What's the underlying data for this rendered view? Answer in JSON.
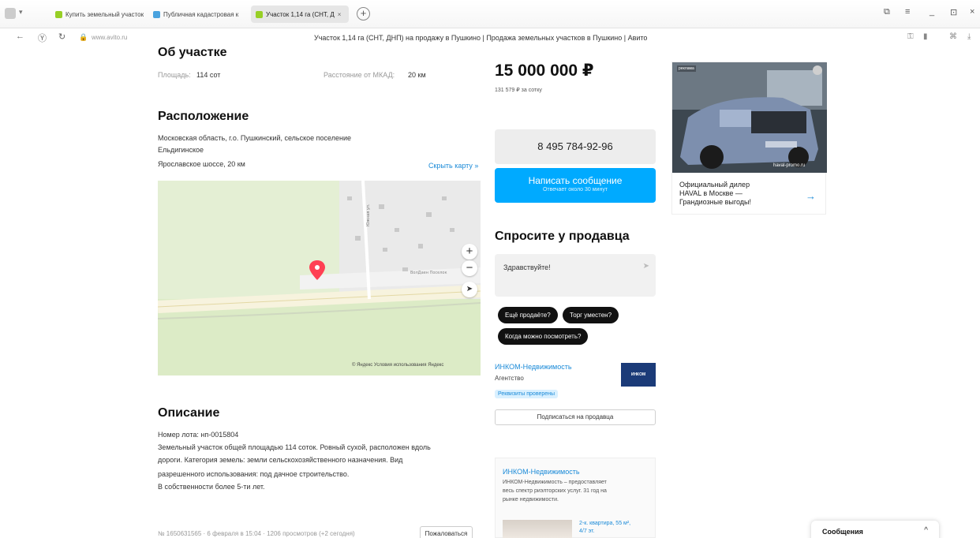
{
  "browser": {
    "tabs": [
      {
        "label": "Купить земельный участок",
        "color": "#97cf26"
      },
      {
        "label": "Публичная кадастровая к",
        "color": "#4aa3df"
      },
      {
        "label": "Участок 1,14 га (СНТ, Д",
        "color": "#97cf26",
        "close": "×"
      }
    ],
    "new_tab": "+",
    "url": "www.avito.ru",
    "page_title": "Участок 1,14 га (СНТ, ДНП) на продажу в Пушкино | Продажа земельных участков в Пушкино | Авито"
  },
  "about": {
    "heading": "Об участке",
    "area_label": "Площадь:",
    "area_value": "114 сот",
    "distance_label": "Расстояние от МКАД:",
    "distance_value": "20 км"
  },
  "location": {
    "heading": "Расположение",
    "address_line1": "Московская область, г.о. Пушкинский, сельское поселение",
    "address_line2": "Ельдигинское",
    "highway": "Ярославское шоссе, 20 км",
    "hide_map": "Скрыть карту »",
    "map_label_street": "Южная ул.",
    "map_label_area": "ВолДаен Поселок",
    "map_footer": "© Яндекс Условия использования  Яндекс",
    "zoom_in": "+",
    "zoom_out": "−",
    "locate": "➤"
  },
  "description": {
    "heading": "Описание",
    "lot": "Номер лота: нп-0015804",
    "text1": "Земельный участок общей площадью 114 соток. Ровный сухой, расположен вдоль",
    "text2": "дороги. Категория земель: земли сельскохозяйственного назначения. Вид",
    "text3": "разрешенного использования: под дачное строительство.",
    "text4": "В собственности более 5-ти лет."
  },
  "footer": {
    "meta": "№ 1650631565 · 6 февраля в 15:04 · 1206 просмотров (+2 сегодня)",
    "complain": "Пожаловаться"
  },
  "offer": {
    "price": "15 000 000 ₽",
    "per_unit": "131 579 ₽ за сотку",
    "phone": "8 495 784-92-96",
    "message_button": "Написать сообщение",
    "message_sub": "Отвечает около 30 минут"
  },
  "ask": {
    "heading": "Спросите у продавца",
    "placeholder": "Здравствуйте!",
    "chips": [
      "Ещё продаёте?",
      "Торг уместен?",
      "Когда можно посмотреть?"
    ]
  },
  "seller": {
    "name": "ИНКОМ-Недвижимость",
    "type": "Агентство",
    "badge": "Реквизиты проверены",
    "logo": "ИНКОМ",
    "subscribe": "Подписаться на продавца"
  },
  "seller_card": {
    "name": "ИНКОМ-Недвижимость",
    "desc1": "ИНКОМ-Недвижимость – предоставляет",
    "desc2": "весь спектр риэлторских услуг. 31 год на",
    "desc3": "рынке недвижимости.",
    "listing1": "2-к. квартира, 55 м²,",
    "listing2": "4/7 эт."
  },
  "ad": {
    "label": "реклама",
    "brand": "haval-promo.ru",
    "line1": "Официальный дилер",
    "line2": "HAVAL в Москве —",
    "line3": "Грандиозные выгоды!",
    "arrow": "→"
  },
  "messages_panel": {
    "title": "Сообщения",
    "chevron": "^"
  }
}
